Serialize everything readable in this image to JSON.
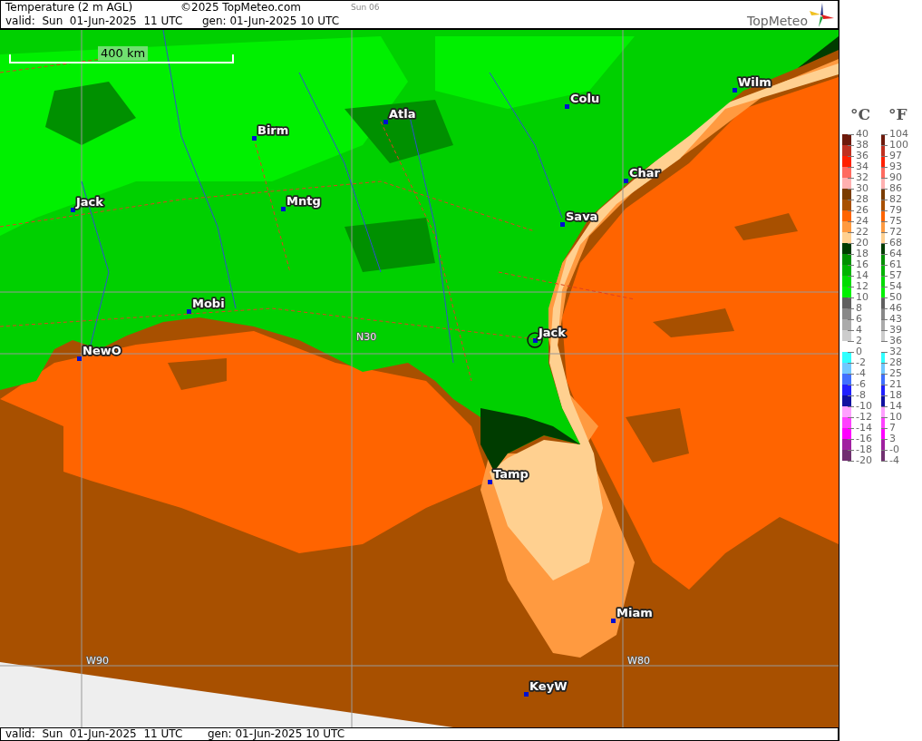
{
  "header": {
    "title": "Temperature (2 m AGL)",
    "copyright": "©2025 TopMeteo.com",
    "day": "Sun 06",
    "valid": "valid:  Sun  01-Jun-2025  11 UTC",
    "generated": "gen: 01-Jun-2025 10 UTC",
    "logo": "TopMeteo"
  },
  "map": {
    "scale_label": "400 km",
    "grid_labels": [
      "N30",
      "W90",
      "W80"
    ],
    "cities": [
      "Wilm",
      "Colu",
      "Atla",
      "Birm",
      "Char",
      "Jack",
      "Mntg",
      "Sava",
      "Mobi",
      "Jack",
      "NewO",
      "Tamp",
      "Miam",
      "KeyW"
    ]
  },
  "legend": {
    "celsius_heading": "°C",
    "fahrenheit_heading": "°F",
    "celsius": [
      "40",
      "38",
      "36",
      "34",
      "32",
      "30",
      "28",
      "26",
      "24",
      "22",
      "20",
      "18",
      "16",
      "14",
      "12",
      "10",
      "8",
      "6",
      "4",
      "2",
      "0",
      "-2",
      "-4",
      "-6",
      "-8",
      "-10",
      "-12",
      "-14",
      "-16",
      "-18",
      "-20"
    ],
    "fahrenheit": [
      "104",
      "100",
      "97",
      "93",
      "90",
      "86",
      "82",
      "79",
      "75",
      "72",
      "68",
      "64",
      "61",
      "57",
      "54",
      "50",
      "46",
      "43",
      "39",
      "36",
      "32",
      "28",
      "25",
      "21",
      "18",
      "14",
      "10",
      "7",
      "3",
      "-0",
      "-4"
    ],
    "bands": [
      {
        "kind": "fill",
        "color": "#6e1a0c"
      },
      {
        "kind": "fill",
        "color": "#c03020"
      },
      {
        "kind": "fill",
        "color": "#ff2000"
      },
      {
        "kind": "fill",
        "color": "#ff6a60"
      },
      {
        "kind": "fill",
        "color": "#ffb0b0"
      },
      {
        "kind": "fill",
        "color": "#7a3c00"
      },
      {
        "kind": "fill",
        "color": "#a85000"
      },
      {
        "kind": "fill",
        "color": "#ff6400"
      },
      {
        "kind": "fill",
        "color": "#ff9a40"
      },
      {
        "kind": "fill",
        "color": "#ffd090"
      },
      {
        "kind": "fill",
        "color": "#003c00"
      },
      {
        "kind": "fill",
        "color": "#009000"
      },
      {
        "kind": "fill",
        "color": "#00b400"
      },
      {
        "kind": "fill",
        "color": "#00dc00"
      },
      {
        "kind": "fill",
        "color": "#00f000"
      },
      {
        "kind": "fill",
        "color": "#606060"
      },
      {
        "kind": "fill",
        "color": "#888888"
      },
      {
        "kind": "fill",
        "color": "#aaaaaa"
      },
      {
        "kind": "fill",
        "color": "#cccccc"
      },
      {
        "kind": "gap"
      },
      {
        "kind": "fill",
        "color": "#30ffff"
      },
      {
        "kind": "fill",
        "color": "#70c8ff"
      },
      {
        "kind": "fill",
        "color": "#4070ff"
      },
      {
        "kind": "fill",
        "color": "#2020ff"
      },
      {
        "kind": "fill",
        "color": "#1010a0"
      },
      {
        "kind": "fill",
        "color": "#ffa0ff"
      },
      {
        "kind": "fill",
        "color": "#ff40ff"
      },
      {
        "kind": "fill",
        "color": "#ff00ff"
      },
      {
        "kind": "fill",
        "color": "#a020a0"
      },
      {
        "kind": "fill",
        "color": "#703070"
      }
    ]
  },
  "footer": {
    "valid": "valid:  Sun  01-Jun-2025  11 UTC",
    "generated": "gen: 01-Jun-2025 10 UTC"
  }
}
